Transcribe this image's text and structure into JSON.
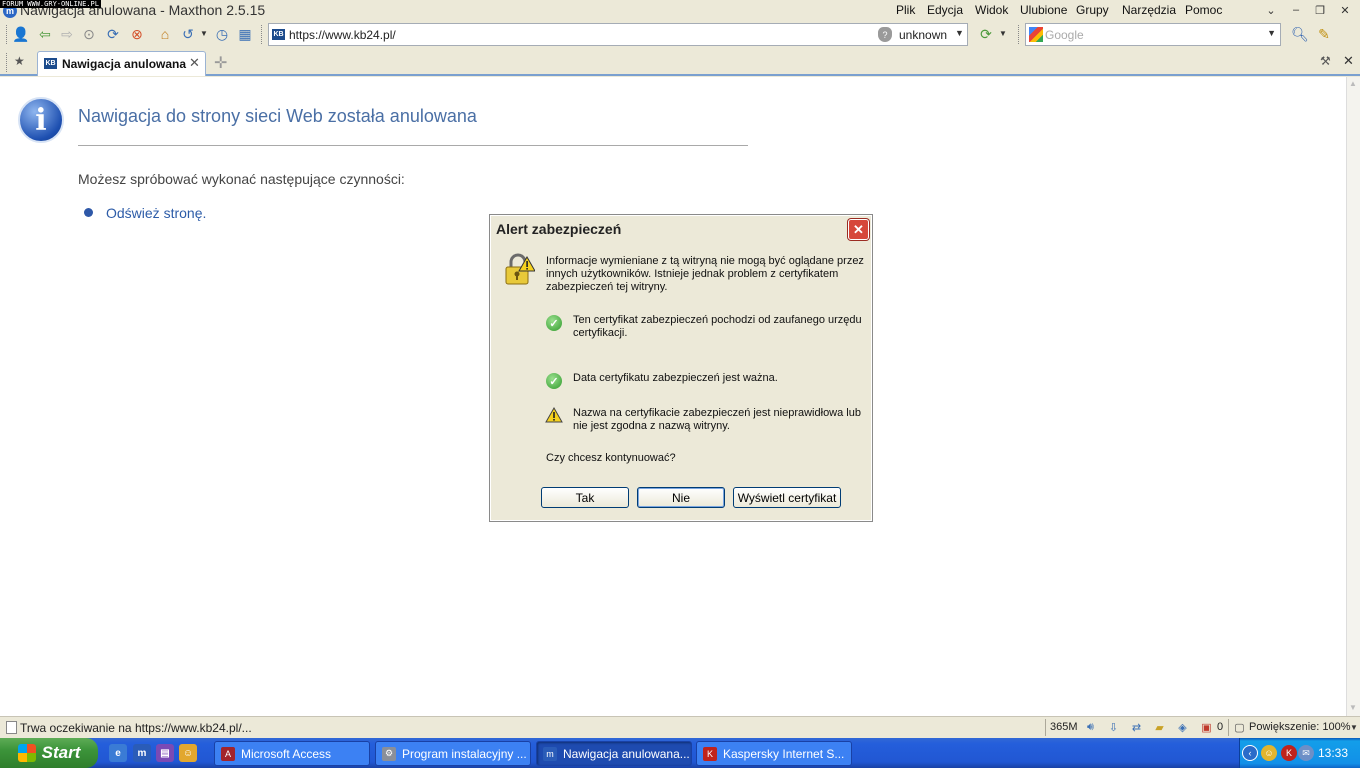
{
  "watermark": "FORUM WWW.GRY-ONLINE.PL",
  "window": {
    "title": "Nawigacja anulowana - Maxthon 2.5.15",
    "menu": [
      "Plik",
      "Edycja",
      "Widok",
      "Ulubione",
      "Grupy",
      "Narzędzia",
      "Pomoc"
    ]
  },
  "address_bar": {
    "url": "https://www.kb24.pl/",
    "certificate_status": "unknown"
  },
  "search": {
    "placeholder": "Google"
  },
  "tabs": [
    {
      "label": "Nawigacja anulowana",
      "active": true
    }
  ],
  "page": {
    "heading": "Nawigacja do strony sieci Web została anulowana",
    "subtitle": "Możesz spróbować wykonać następujące czynności:",
    "link": "Odśwież stronę."
  },
  "dialog": {
    "title": "Alert zabezpieczeń",
    "intro": "Informacje wymieniane z tą witryną nie mogą być oglądane przez innych użytkowników. Istnieje jednak problem z certyfikatem zabezpieczeń tej witryny.",
    "items": [
      {
        "status": "ok",
        "text": "Ten certyfikat zabezpieczeń pochodzi od zaufanego urzędu certyfikacji."
      },
      {
        "status": "ok",
        "text": "Data certyfikatu zabezpieczeń jest ważna."
      },
      {
        "status": "warning",
        "text": "Nazwa na certyfikacie zabezpieczeń jest nieprawidłowa lub nie jest zgodna z nazwą witryny."
      }
    ],
    "question": "Czy chcesz kontynuować?",
    "buttons": {
      "yes": "Tak",
      "no": "Nie",
      "view_cert": "Wyświetl certyfikat"
    }
  },
  "status_bar": {
    "text": "Trwa oczekiwanie na https://www.kb24.pl/...",
    "memory": "365M",
    "popup_count": "0",
    "zoom": "Powiększenie: 100%"
  },
  "taskbar": {
    "start": "Start",
    "tasks": [
      {
        "label": "Microsoft Access",
        "active": false
      },
      {
        "label": "Program instalacyjny ...",
        "active": false
      },
      {
        "label": "Nawigacja anulowana...",
        "active": true
      },
      {
        "label": "Kaspersky Internet S...",
        "active": false
      }
    ],
    "clock": "13:33"
  },
  "colors": {
    "heading": "#4a6fa5",
    "link": "#2d5ca8",
    "taskbar": "#245edb",
    "start_button": "#3c943a",
    "dialog_close": "#d6473a"
  }
}
